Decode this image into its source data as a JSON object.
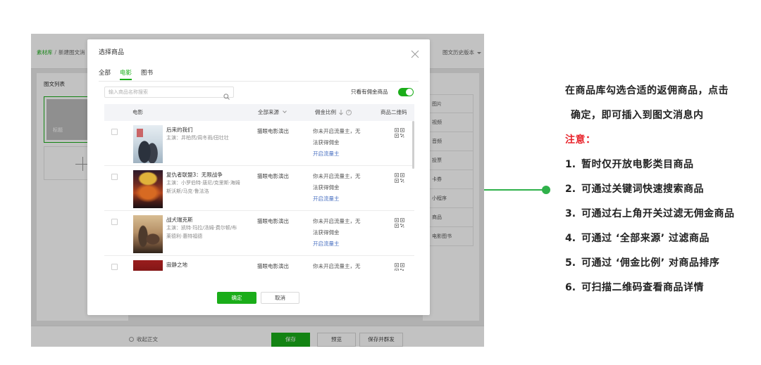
{
  "editor": {
    "breadcrumb": {
      "root": "素材库",
      "separator": "/",
      "current": "新建图文消"
    },
    "history_version": "图文历史版本",
    "list_title": "图文列表",
    "card_title": "标题",
    "side_tools": [
      "图片",
      "视频",
      "音频",
      "投票",
      "卡券",
      "小程序",
      "商品",
      "电影图书"
    ],
    "collapse_text": "收起正文",
    "buttons": {
      "save": "保存",
      "preview": "预览",
      "save_and_send": "保存并群发"
    }
  },
  "modal": {
    "title": "选择商品",
    "tabs": [
      {
        "label": "全部",
        "active": false
      },
      {
        "label": "电影",
        "active": true
      },
      {
        "label": "图书",
        "active": false
      }
    ],
    "search_placeholder": "输入商品名称搜索",
    "commission_filter_label": "只看有佣金商品",
    "commission_filter_on": true,
    "columns": {
      "movie": "电影",
      "source": "全部来源",
      "commission": "佣金比例",
      "qr_code": "商品二维码"
    },
    "rows": [
      {
        "title": "后来的我们",
        "cast": "主演：井柏然/周冬雨/田壮壮",
        "source": "猫眼电影演出",
        "commission_note": "你未开启流量主，无法获得佣金",
        "commission_link": "开启流量主"
      },
      {
        "title": "复仇者联盟3：无限战争",
        "cast": "主演：小罗伯特·唐尼/克里斯·海姆斯沃斯/马克·鲁法洛",
        "source": "猫眼电影演出",
        "commission_note": "你未开启流量主，无法获得佣金",
        "commission_link": "开启流量主"
      },
      {
        "title": "战犬瑞克斯",
        "cast": "主演：凯特·玛拉/汤姆·费尔顿/布莱德利·惠特福德",
        "source": "猫眼电影演出",
        "commission_note": "你未开启流量主，无法获得佣金",
        "commission_link": "开启流量主"
      },
      {
        "title": "寂静之地",
        "source": "猫眼电影演出",
        "commission_note": "你未开启流量主，无"
      }
    ],
    "confirm_label": "确定",
    "cancel_label": "取消"
  },
  "annotation": {
    "intro_line1": "在商品库勾选合适的返佣商品，点击",
    "intro_line2": "确定，即可插入到图文消息内",
    "note_label": "注意：",
    "items": [
      {
        "num": "1.",
        "text": "暂时仅开放电影类目商品"
      },
      {
        "num": "2.",
        "text": "可通过关键词快速搜索商品"
      },
      {
        "num": "3.",
        "text": "可通过右上角开关过滤无佣金商品"
      },
      {
        "num": "4.",
        "text": "可通过 ‘全部来源’ 过滤商品"
      },
      {
        "num": "5.",
        "text": "可通过 ‘佣金比例’ 对商品排序"
      },
      {
        "num": "6.",
        "text": "可扫描二维码查看商品详情"
      }
    ]
  },
  "colors": {
    "brand_green": "#1aad19",
    "connector_green": "#2fb14a",
    "note_red": "#e8232b",
    "link_blue": "#4b72c2"
  }
}
